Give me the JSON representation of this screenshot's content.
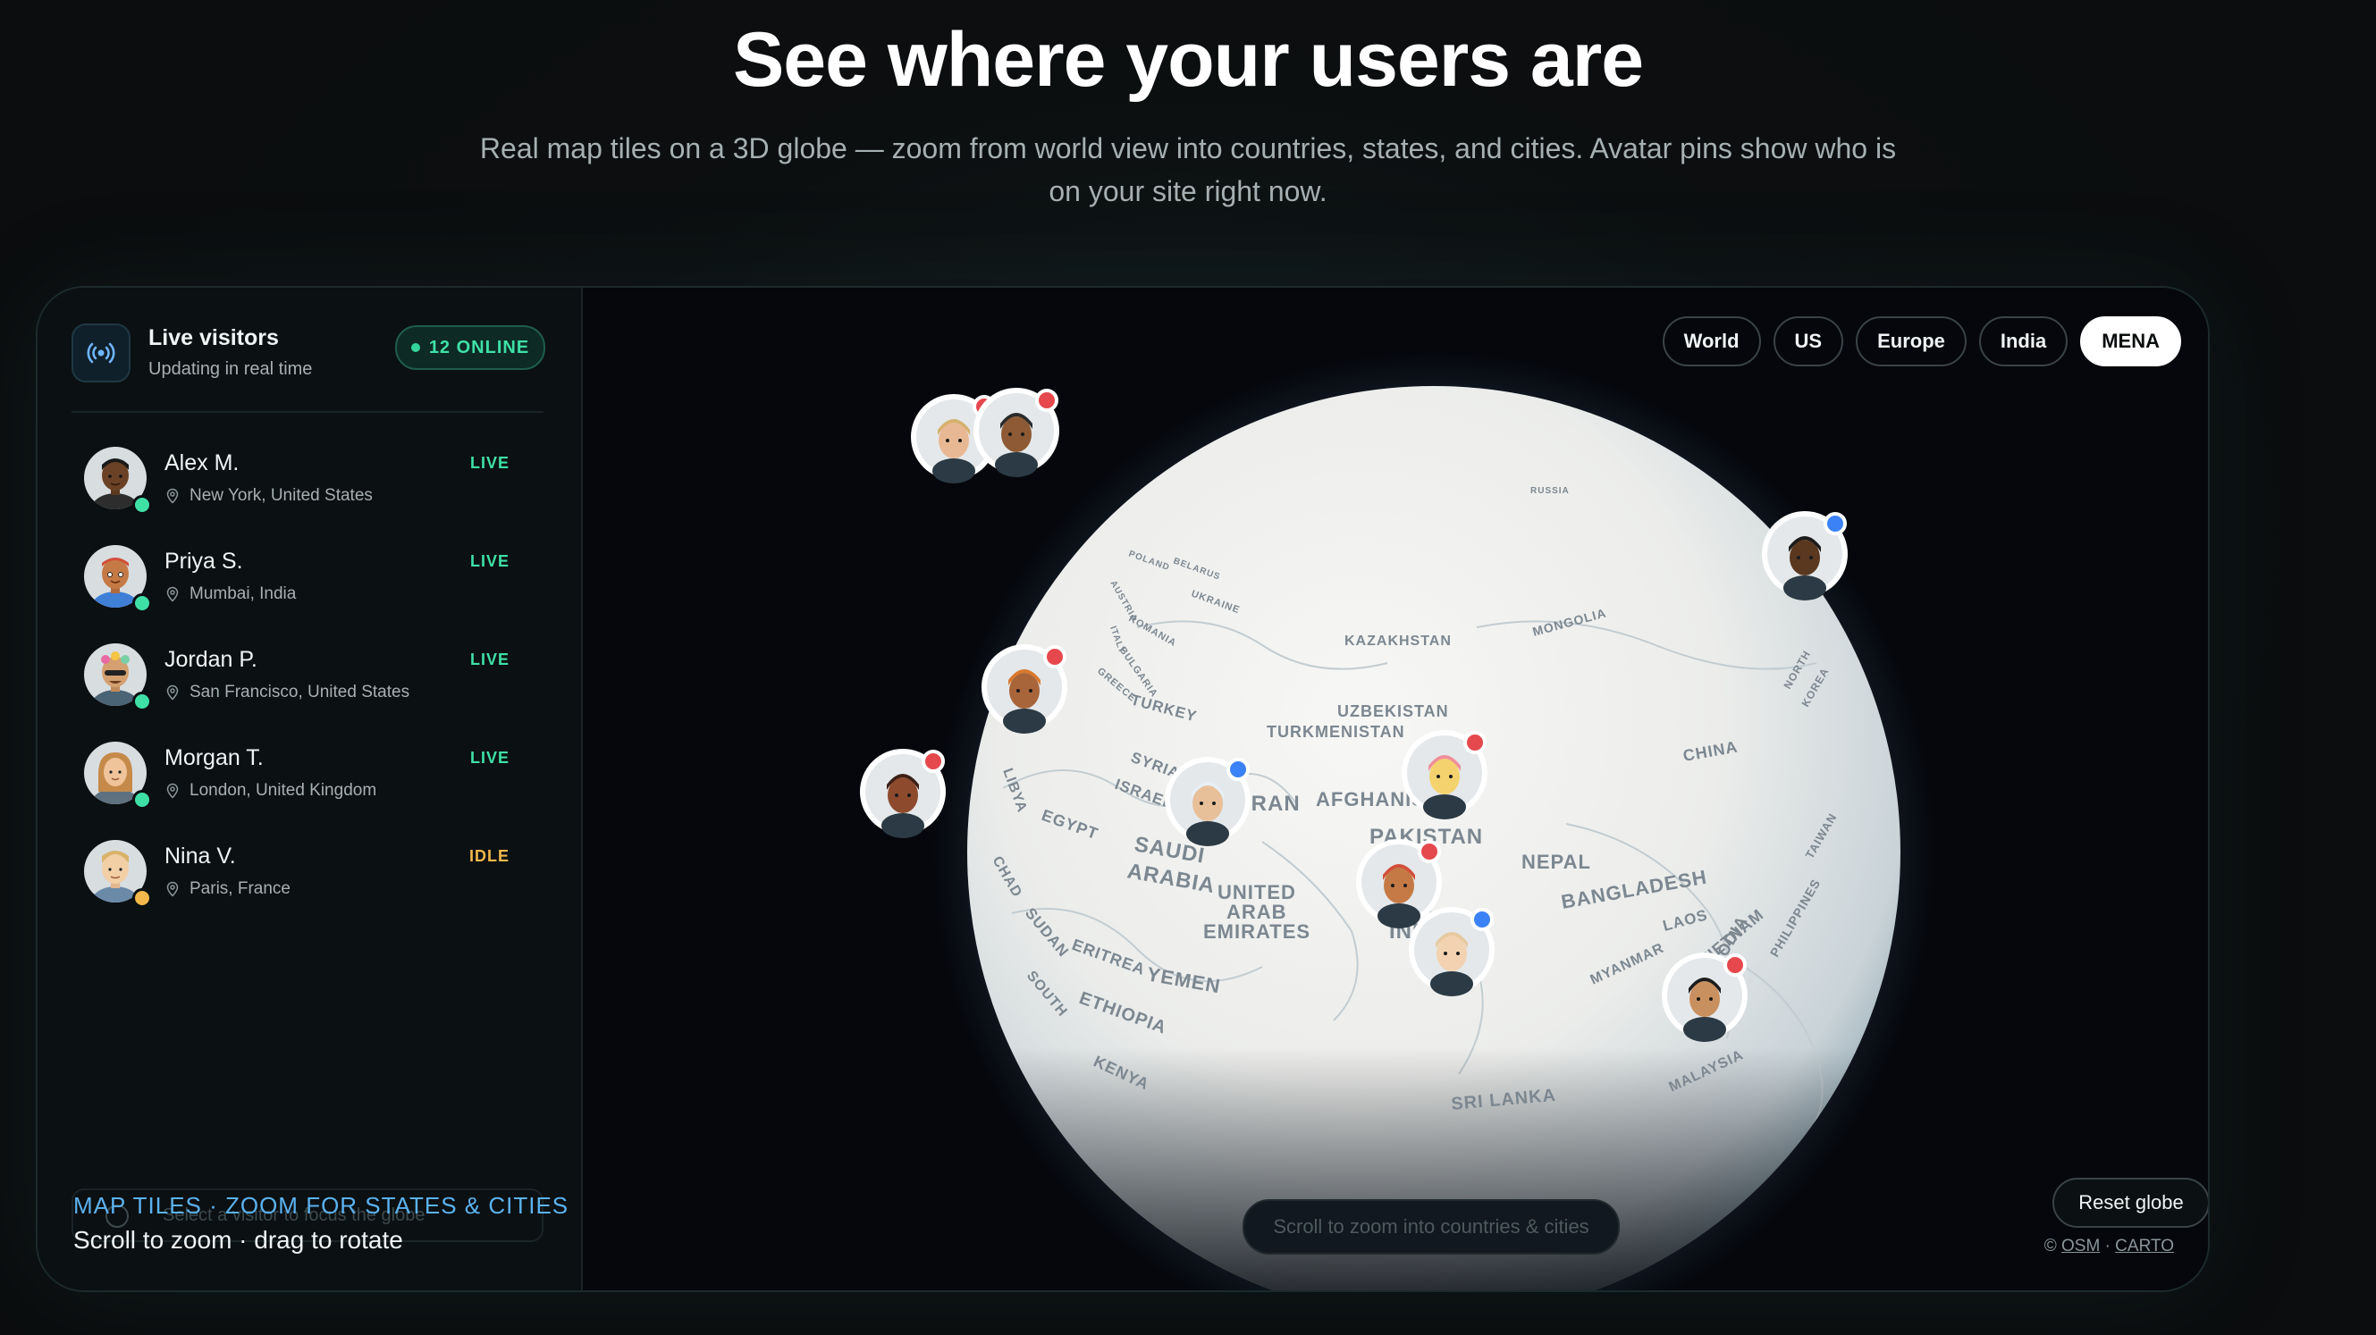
{
  "hero": {
    "title": "See where your users are",
    "subtitle": "Real map tiles on a 3D globe — zoom from world view into countries, states, and cities. Avatar pins show who is on your site right now."
  },
  "sidebar": {
    "title": "Live visitors",
    "subtitle": "Updating in real time",
    "online_badge": "12 ONLINE",
    "icon": "broadcast-icon",
    "visitors": [
      {
        "name": "Alex M.",
        "location": "New York, United States",
        "status": "LIVE"
      },
      {
        "name": "Priya S.",
        "location": "Mumbai, India",
        "status": "LIVE"
      },
      {
        "name": "Jordan P.",
        "location": "San Francisco, United States",
        "status": "LIVE"
      },
      {
        "name": "Morgan T.",
        "location": "London, United Kingdom",
        "status": "LIVE"
      },
      {
        "name": "Nina V.",
        "location": "Paris, France",
        "status": "IDLE"
      }
    ],
    "hint": "Select a visitor to focus the globe",
    "footer_line1": "MAP TILES · ZOOM FOR STATES & CITIES",
    "footer_line2": "Scroll to zoom · drag to rotate"
  },
  "map": {
    "tabs": [
      "World",
      "US",
      "Europe",
      "India",
      "MENA"
    ],
    "active_tab": "MENA",
    "scroll_hint": "Scroll to zoom into countries & cities",
    "reset_label": "Reset globe",
    "credit_prefix": "©",
    "credit_osm": "OSM",
    "credit_sep": "·",
    "credit_carto": "CARTO",
    "labels": [
      "RUSSIA",
      "POLAND",
      "BELARUS",
      "UKRAINE",
      "ROMANIA",
      "AUSTRIA",
      "ITALY",
      "BULGARIA",
      "GREECE",
      "KAZAKHSTAN",
      "MONGOLIA",
      "TURKEY",
      "UZBEKISTAN",
      "TURKMENISTAN",
      "SYRIA",
      "ISRAEL",
      "IRAN",
      "AFGHANISTAN",
      "PAKISTAN",
      "CHINA",
      "NEPAL",
      "BANGLADESH",
      "LIBYA",
      "EGYPT",
      "SAUDI",
      "ARABIA",
      "UNITED",
      "ARAB",
      "EMIRATES",
      "CHAD",
      "SUDAN",
      "ERITREA",
      "YEMEN",
      "SOUTH",
      "ETHIOPIA",
      "INDIA",
      "KENYA",
      "SRI LANKA",
      "MYANMAR",
      "LAOS",
      "VIETNAM",
      "CAMBODIA",
      "MALAYSIA",
      "PHILIPPINES",
      "TAIWAN",
      "NORTH",
      "KOREA"
    ]
  },
  "colors": {
    "live": "#3ee0a6",
    "idle": "#f2b84b",
    "accent": "#5bb2f0",
    "pin_red": "#e5484d",
    "pin_blue": "#3b82f6"
  }
}
